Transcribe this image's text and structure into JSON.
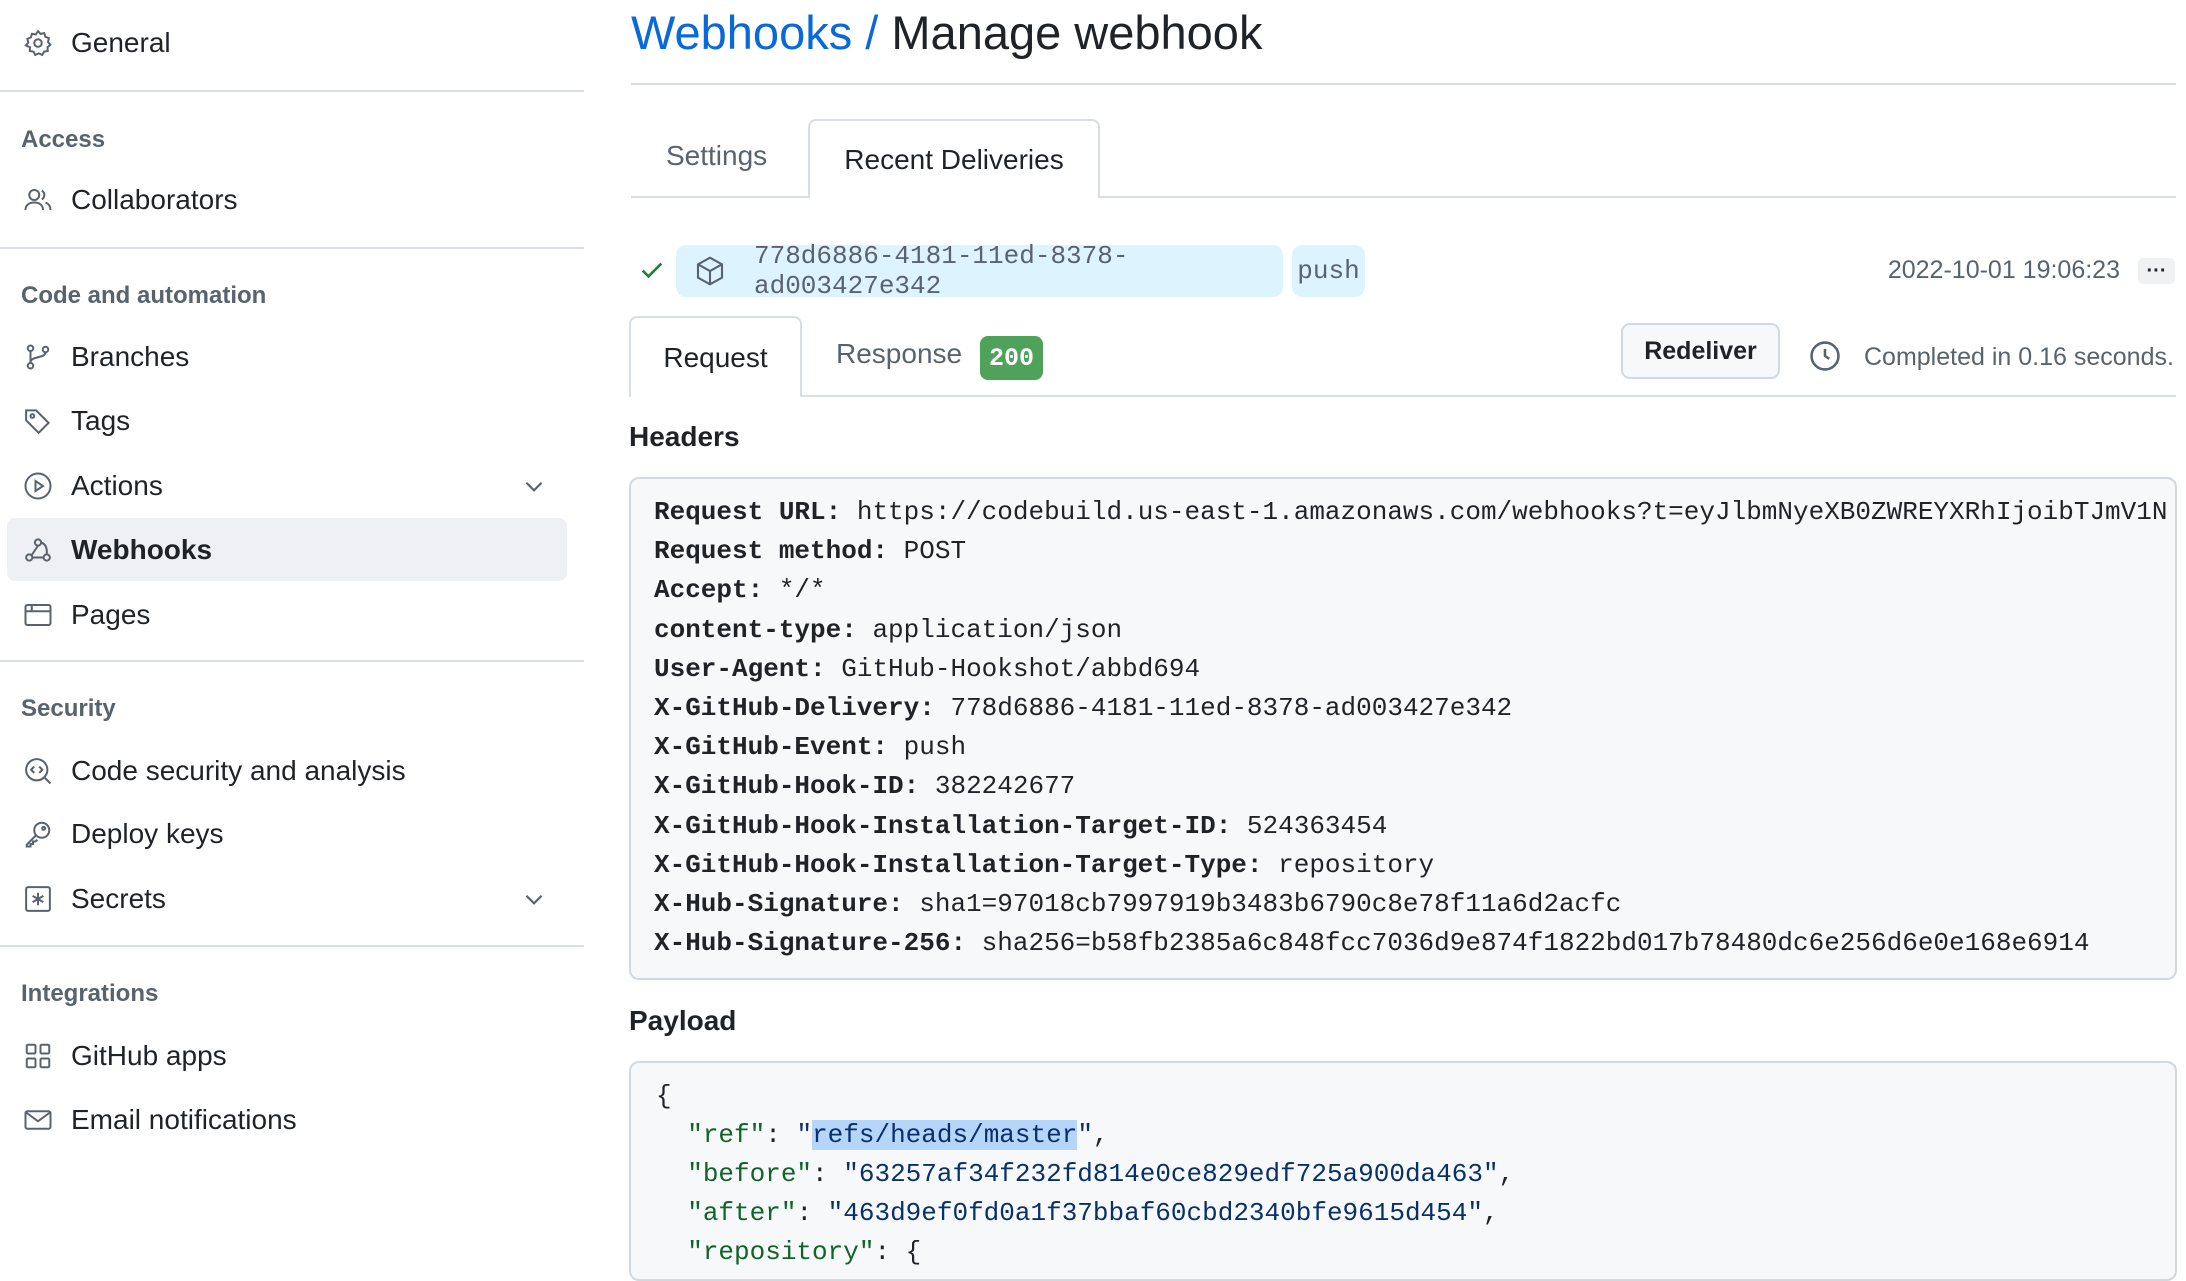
{
  "sidebar": {
    "general": "General",
    "sections": [
      {
        "title": "Access",
        "items": [
          {
            "label": "Collaborators",
            "icon": "people-icon"
          }
        ]
      },
      {
        "title": "Code and automation",
        "items": [
          {
            "label": "Branches",
            "icon": "branch-icon"
          },
          {
            "label": "Tags",
            "icon": "tag-icon"
          },
          {
            "label": "Actions",
            "icon": "play-icon"
          },
          {
            "label": "Webhooks",
            "icon": "webhook-icon",
            "active": true
          },
          {
            "label": "Pages",
            "icon": "browser-icon"
          }
        ]
      },
      {
        "title": "Security",
        "items": [
          {
            "label": "Code security and analysis",
            "icon": "codescan-icon"
          },
          {
            "label": "Deploy keys",
            "icon": "key-icon"
          },
          {
            "label": "Secrets",
            "icon": "asterisk-icon"
          }
        ]
      },
      {
        "title": "Integrations",
        "items": [
          {
            "label": "GitHub apps",
            "icon": "apps-icon"
          },
          {
            "label": "Email notifications",
            "icon": "mail-icon"
          }
        ]
      }
    ]
  },
  "header": {
    "breadcrumb_link": "Webhooks",
    "separator": "/",
    "title": "Manage webhook"
  },
  "tabs": [
    "Settings",
    "Recent Deliveries"
  ],
  "delivery": {
    "guid": "778d6886-4181-11ed-8378-ad003427e342",
    "event": "push",
    "timestamp": "2022-10-01 19:06:23",
    "more": "···",
    "status": "success"
  },
  "subtabs": {
    "request": "Request",
    "response": "Response",
    "status_code": "200"
  },
  "redeliver": "Redeliver",
  "completed": "Completed in 0.16 seconds.",
  "headers_title": "Headers",
  "headers": [
    {
      "k": "Request URL:",
      "v": "https://codebuild.us-east-1.amazonaws.com/webhooks?t=eyJlbmNyeXB0ZWREYXRhIjoibTJmV1N"
    },
    {
      "k": "Request method:",
      "v": "POST"
    },
    {
      "k": "Accept:",
      "v": "*/*"
    },
    {
      "k": "content-type:",
      "v": "application/json"
    },
    {
      "k": "User-Agent:",
      "v": "GitHub-Hookshot/abbd694"
    },
    {
      "k": "X-GitHub-Delivery:",
      "v": "778d6886-4181-11ed-8378-ad003427e342"
    },
    {
      "k": "X-GitHub-Event:",
      "v": "push"
    },
    {
      "k": "X-GitHub-Hook-ID:",
      "v": "382242677"
    },
    {
      "k": "X-GitHub-Hook-Installation-Target-ID:",
      "v": "524363454"
    },
    {
      "k": "X-GitHub-Hook-Installation-Target-Type:",
      "v": "repository"
    },
    {
      "k": "X-Hub-Signature:",
      "v": "sha1=97018cb7997919b3483b6790c8e78f11a6d2acfc"
    },
    {
      "k": "X-Hub-Signature-256:",
      "v": "sha256=b58fb2385a6c848fcc7036d9e874f1822bd017b78480dc6e256d6e0e168e6914"
    }
  ],
  "payload_title": "Payload",
  "payload": {
    "open": "{",
    "ref_key": "\"ref\"",
    "ref_val": "refs/heads/master",
    "before_key": "\"before\"",
    "before_val": "\"63257af34f232fd814e0ce829edf725a900da463\"",
    "after_key": "\"after\"",
    "after_val": "\"463d9ef0fd0a1f37bbaf60cbd2340bfe9615d454\"",
    "repo_key": "\"repository\"",
    "repo_val": "{"
  },
  "colors": {
    "link": "#0969da",
    "success": "#1a7f37",
    "badge": "#4ea25a",
    "pill": "#ddf4ff",
    "selection": "#b6d5fb"
  }
}
